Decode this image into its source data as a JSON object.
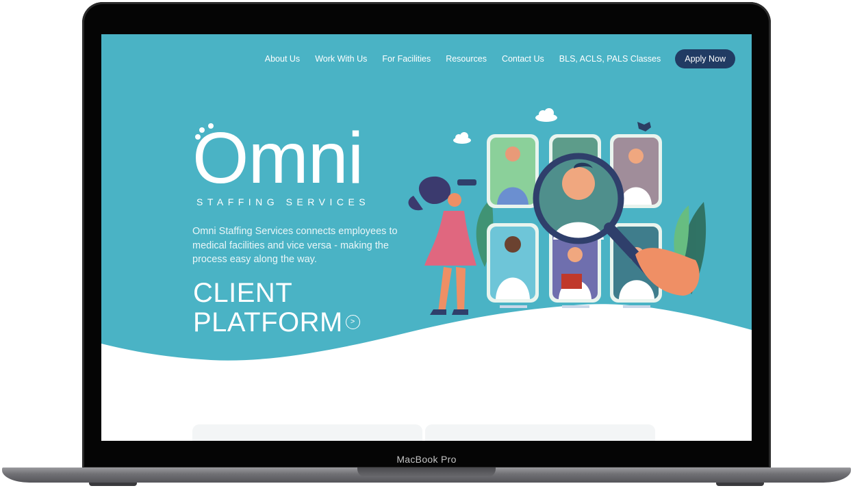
{
  "device": {
    "label": "MacBook Pro"
  },
  "nav": {
    "items": [
      "About Us",
      "Work With Us",
      "For Facilities",
      "Resources",
      "Contact Us",
      "BLS, ACLS, PALS Classes"
    ],
    "apply_label": "Apply Now"
  },
  "brand": {
    "wordmark": "Omni",
    "tagline": "STAFFING SERVICES"
  },
  "hero": {
    "description": "Omni Staffing Services connects employees to medical facilities and vice versa - making the process easy along the way.",
    "cta_line1": "CLIENT",
    "cta_line2": "PLATFORM",
    "cta_icon": "chevron-right-icon"
  },
  "colors": {
    "hero_teal": "#4ab3c5",
    "button_navy": "#213b63",
    "page_bg": "#ffffff"
  }
}
